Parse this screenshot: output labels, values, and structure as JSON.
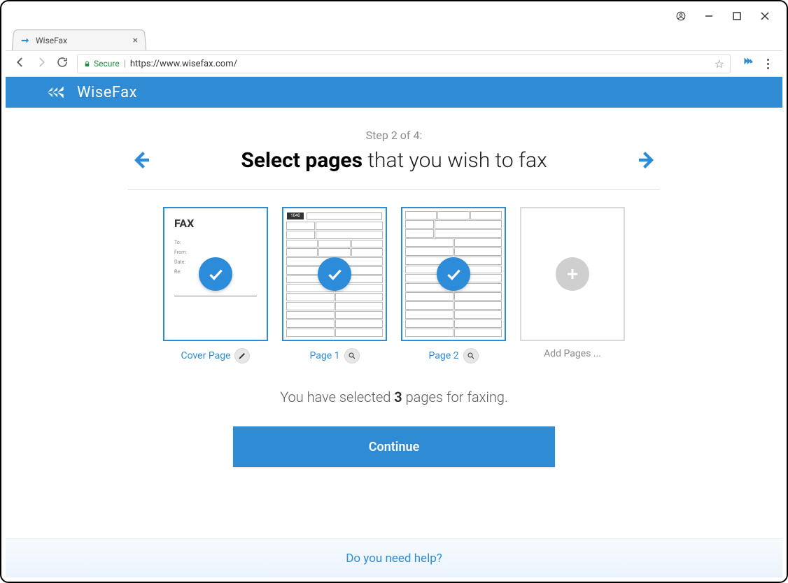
{
  "window": {
    "tab_title": "WiseFax"
  },
  "address_bar": {
    "secure_label": "Secure",
    "url": "https://www.wisefax.com/"
  },
  "brand": {
    "name": "WiseFax"
  },
  "wizard": {
    "step_label": "Step 2 of 4:",
    "headline_bold": "Select pages",
    "headline_rest": " that you wish to fax"
  },
  "pages": {
    "cover": {
      "label": "Cover Page",
      "title_text": "FAX"
    },
    "p1": {
      "label": "Page 1",
      "form_id": "1040"
    },
    "p2": {
      "label": "Page 2"
    },
    "add": {
      "label": "Add Pages ..."
    }
  },
  "summary": {
    "prefix": "You have selected ",
    "count": "3",
    "suffix": " pages for faxing."
  },
  "actions": {
    "continue": "Continue"
  },
  "help": {
    "text": "Do you need help?"
  }
}
